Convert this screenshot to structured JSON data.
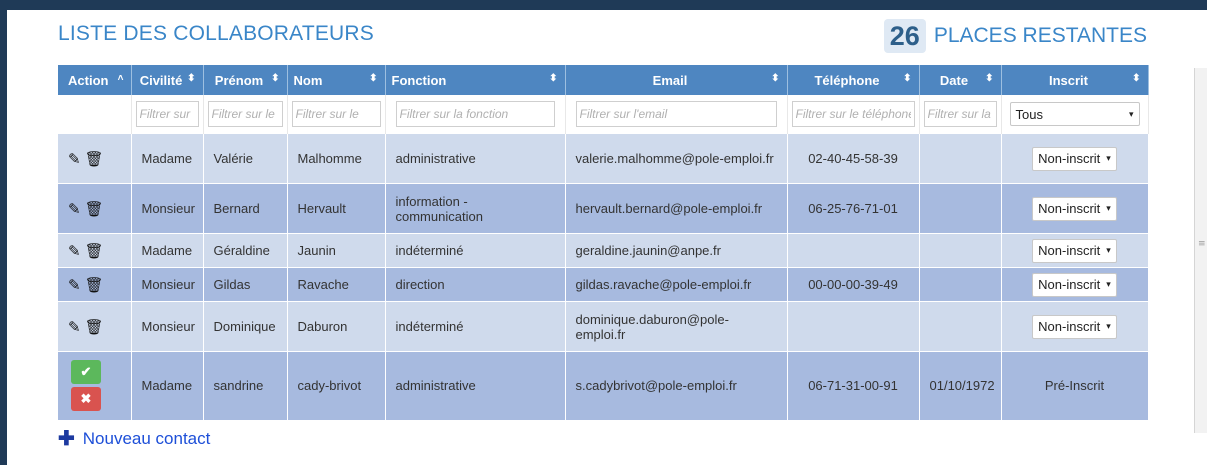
{
  "title": "LISTE DES COLLABORATEURS",
  "places": {
    "count": "26",
    "label": "PLACES RESTANTES"
  },
  "columns": [
    {
      "label": "Action",
      "sort": "˄"
    },
    {
      "label": "Civilité",
      "sort": "⬍"
    },
    {
      "label": "Prénom",
      "sort": "⬍"
    },
    {
      "label": "Nom",
      "sort": "⬍"
    },
    {
      "label": "Fonction",
      "sort": "⬍"
    },
    {
      "label": "Email",
      "sort": "⬍"
    },
    {
      "label": "Téléphone",
      "sort": "⬍"
    },
    {
      "label": "Date",
      "sort": "⬍"
    },
    {
      "label": "Inscrit",
      "sort": "⬍"
    }
  ],
  "filters": {
    "civilite": "Filtrer sur",
    "prenom": "Filtrer sur le",
    "nom": "Filtrer sur le",
    "fonction": "Filtrer sur la fonction",
    "email": "Filtrer sur l'email",
    "telephone": "Filtrer sur le téléphone",
    "date": "Filtrer sur la",
    "inscrit": "Tous"
  },
  "rows": [
    {
      "civilite": "Madame",
      "prenom": "Valérie",
      "nom": "Malhomme",
      "fonction": "administrative",
      "email": "valerie.malhomme@pole-emploi.fr",
      "telephone": "02-40-45-58-39",
      "date": "",
      "inscrit": "Non-inscrit"
    },
    {
      "civilite": "Monsieur",
      "prenom": "Bernard",
      "nom": "Hervault",
      "fonction": "information - communication",
      "email": "hervault.bernard@pole-emploi.fr",
      "telephone": "06-25-76-71-01",
      "date": "",
      "inscrit": "Non-inscrit"
    },
    {
      "civilite": "Madame",
      "prenom": "Géraldine",
      "nom": "Jaunin",
      "fonction": "indéterminé",
      "email": "geraldine.jaunin@anpe.fr",
      "telephone": "",
      "date": "",
      "inscrit": "Non-inscrit"
    },
    {
      "civilite": "Monsieur",
      "prenom": "Gildas",
      "nom": "Ravache",
      "fonction": "direction",
      "email": "gildas.ravache@pole-emploi.fr",
      "telephone": "00-00-00-39-49",
      "date": "",
      "inscrit": "Non-inscrit"
    },
    {
      "civilite": "Monsieur",
      "prenom": "Dominique",
      "nom": "Daburon",
      "fonction": "indéterminé",
      "email": "dominique.daburon@pole-emploi.fr",
      "telephone": "",
      "date": "",
      "inscrit": "Non-inscrit"
    },
    {
      "civilite": "Madame",
      "prenom": "sandrine",
      "nom": "cady-brivot",
      "fonction": "administrative",
      "email": "s.cadybrivot@pole-emploi.fr",
      "telephone": "06-71-31-00-91",
      "date": "01/10/1972",
      "inscrit": "Pré-Inscrit"
    }
  ],
  "icons": {
    "edit": "pencil-icon",
    "delete": "trash-icon",
    "confirm": "check-icon",
    "cancel": "close-icon",
    "caret": "▾",
    "check": "✔",
    "cross": "✖",
    "plus": "✚"
  },
  "new_contact": "Nouveau contact"
}
